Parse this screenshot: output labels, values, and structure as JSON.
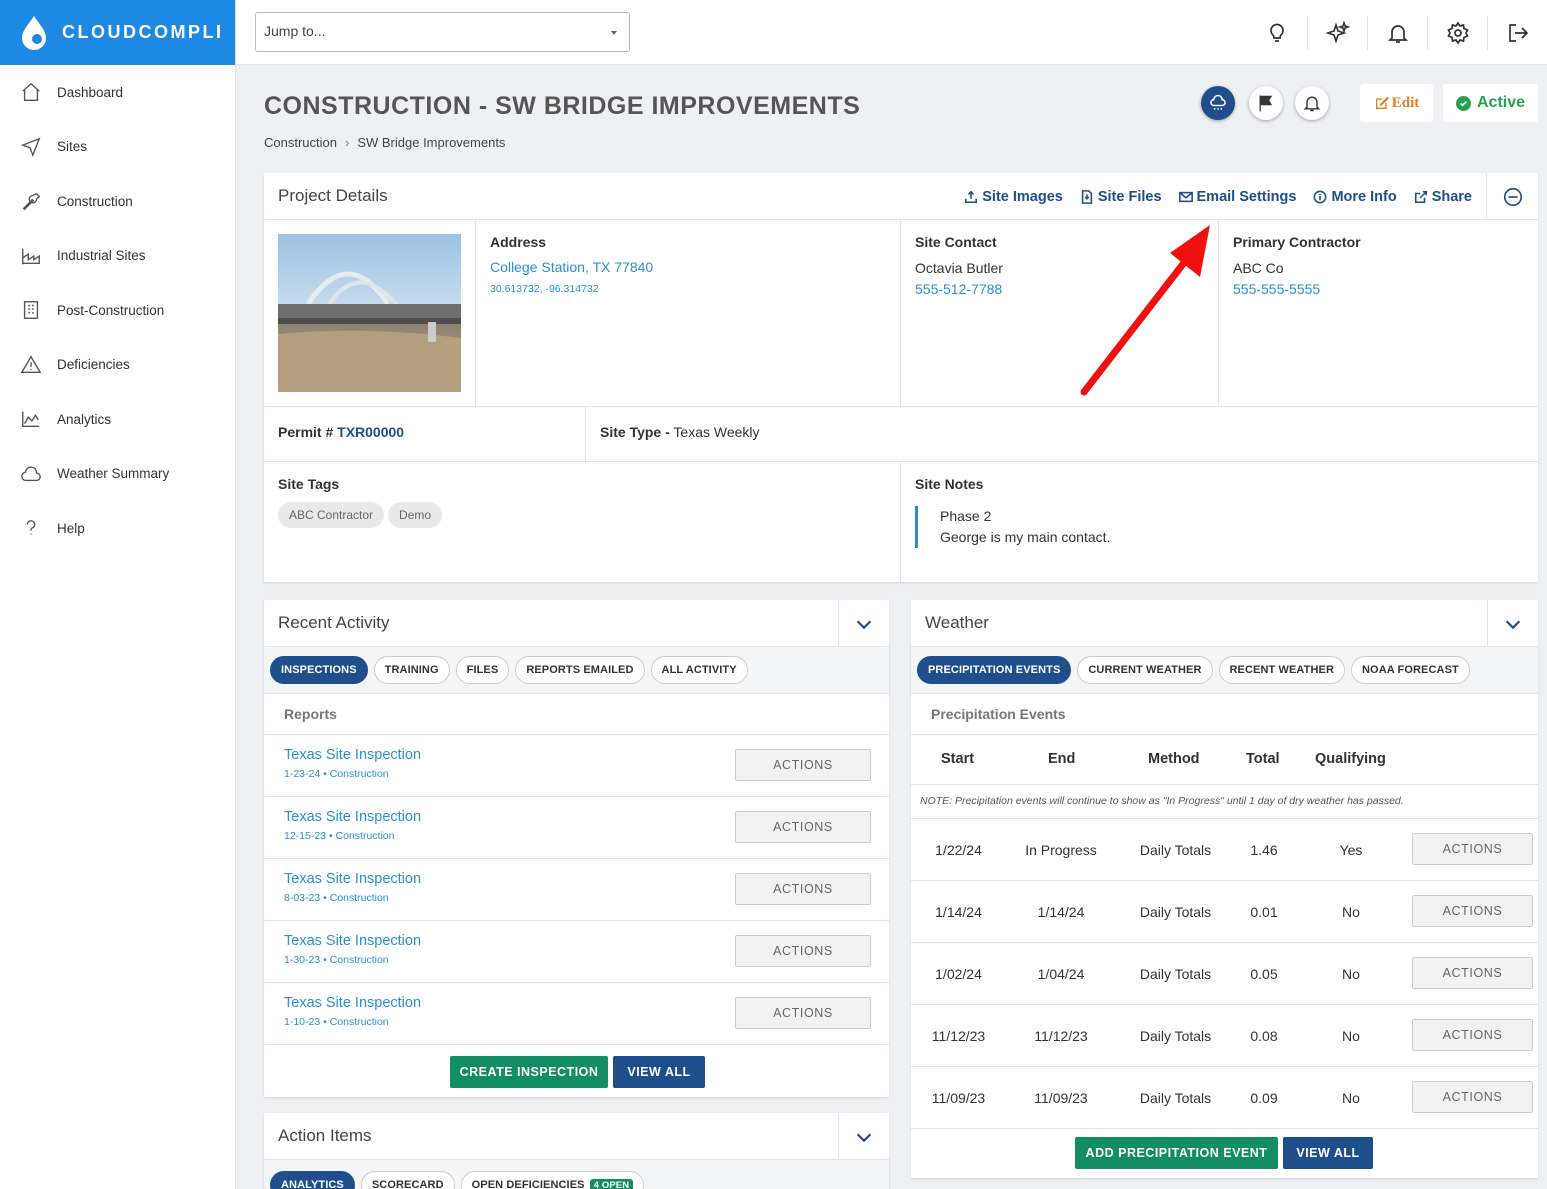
{
  "app": {
    "brand": "CLOUDCOMPLI",
    "accent": "#1e88e5",
    "navy": "#1f4e8c",
    "green": "#138d63"
  },
  "sidebar": {
    "items": [
      {
        "label": "Dashboard",
        "icon": "home-icon"
      },
      {
        "label": "Sites",
        "icon": "navigation-icon"
      },
      {
        "label": "Construction",
        "icon": "wrench-icon"
      },
      {
        "label": "Industrial Sites",
        "icon": "factory-icon"
      },
      {
        "label": "Post-Construction",
        "icon": "building-icon"
      },
      {
        "label": "Deficiencies",
        "icon": "warning-icon"
      },
      {
        "label": "Analytics",
        "icon": "chart-icon"
      },
      {
        "label": "Weather Summary",
        "icon": "cloud-icon"
      },
      {
        "label": "Help",
        "icon": "help-icon"
      }
    ]
  },
  "topbar": {
    "jump_placeholder": "Jump to..."
  },
  "page": {
    "title": "CONSTRUCTION - SW BRIDGE IMPROVEMENTS",
    "breadcrumb": [
      "Construction",
      "SW Bridge Improvements"
    ],
    "edit_label": "Edit",
    "status_label": "Active"
  },
  "project": {
    "header": "Project Details",
    "links": [
      "Site Images",
      "Site Files",
      "Email Settings",
      "More Info",
      "Share"
    ],
    "address_label": "Address",
    "address": "College Station, TX 77840",
    "coords": "30.613732, -96.314732",
    "contact_label": "Site Contact",
    "contact_name": "Octavia Butler",
    "contact_phone": "555-512-7788",
    "contractor_label": "Primary Contractor",
    "contractor_name": "ABC Co",
    "contractor_phone": "555-555-5555",
    "permit_label": "Permit #",
    "permit": "TXR00000",
    "site_type_label": "Site Type -",
    "site_type": "Texas Weekly",
    "tags_label": "Site Tags",
    "tags": [
      "ABC Contractor",
      "Demo"
    ],
    "notes_label": "Site Notes",
    "notes": [
      "Phase 2",
      "George is my main contact."
    ]
  },
  "recent": {
    "header": "Recent Activity",
    "tabs": [
      "INSPECTIONS",
      "TRAINING",
      "FILES",
      "REPORTS EMAILED",
      "ALL ACTIVITY"
    ],
    "sub": "Reports",
    "rows": [
      {
        "title": "Texas Site Inspection",
        "sub": "1-23-24 • Construction"
      },
      {
        "title": "Texas Site Inspection",
        "sub": "12-15-23 • Construction"
      },
      {
        "title": "Texas Site Inspection",
        "sub": "8-03-23 • Construction"
      },
      {
        "title": "Texas Site Inspection",
        "sub": "1-30-23 • Construction"
      },
      {
        "title": "Texas Site Inspection",
        "sub": "1-10-23 • Construction"
      }
    ],
    "actions_label": "ACTIONS",
    "create_label": "CREATE INSPECTION",
    "view_all_label": "VIEW ALL"
  },
  "weather": {
    "header": "Weather",
    "tabs": [
      "PRECIPITATION EVENTS",
      "CURRENT WEATHER",
      "RECENT WEATHER",
      "NOAA FORECAST"
    ],
    "sub": "Precipitation Events",
    "columns": [
      "Start",
      "End",
      "Method",
      "Total",
      "Qualifying"
    ],
    "note": "NOTE: Precipitation events will continue to show as \"In Progress\" until 1 day of dry weather has passed.",
    "rows": [
      [
        "1/22/24",
        "In Progress",
        "Daily Totals",
        "1.46",
        "Yes"
      ],
      [
        "1/14/24",
        "1/14/24",
        "Daily Totals",
        "0.01",
        "No"
      ],
      [
        "1/02/24",
        "1/04/24",
        "Daily Totals",
        "0.05",
        "No"
      ],
      [
        "11/12/23",
        "11/12/23",
        "Daily Totals",
        "0.08",
        "No"
      ],
      [
        "11/09/23",
        "11/09/23",
        "Daily Totals",
        "0.09",
        "No"
      ]
    ],
    "actions_label": "ACTIONS",
    "add_label": "ADD PRECIPITATION EVENT",
    "view_all_label": "VIEW ALL"
  },
  "action_items": {
    "header": "Action Items",
    "tabs": [
      "ANALYTICS",
      "SCORECARD",
      "OPEN DEFICIENCIES"
    ],
    "badge": "4 OPEN"
  }
}
